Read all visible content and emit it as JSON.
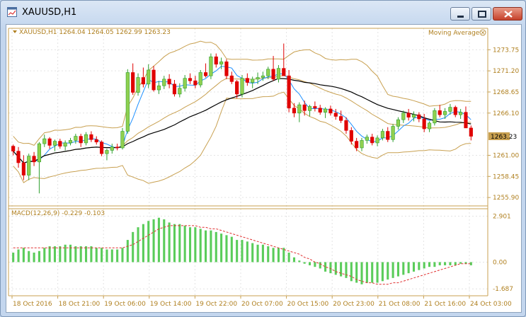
{
  "window": {
    "title": "XAUUSD,H1",
    "buttons": {
      "minimize": "minimize",
      "maximize": "maximize",
      "close": "close"
    }
  },
  "chart": {
    "header_text": "XAUUSD,H1  1264.04 1264.05 1262.99 1263.23",
    "indicator_label": "Moving Average",
    "current_price_label": "1263.23",
    "macd_label": "MACD(12,26,9) -0.229 -0.103",
    "colors": {
      "bull_candle": "#2ea02e",
      "bull_body": "#90d050",
      "bear_candle": "#e00000",
      "bollinger": "#c8a050",
      "ma_fast": "#1e90ff",
      "ma_slow": "#000000",
      "macd_hist": "#5acc5a",
      "macd_signal": "#e03030",
      "axis_text": "#b08020",
      "grid": "#e3e3e3"
    }
  },
  "chart_data": {
    "type": "candlestick",
    "symbol": "XAUUSD",
    "timeframe": "H1",
    "last_ohlc": {
      "open": 1264.04,
      "high": 1264.05,
      "low": 1262.99,
      "close": 1263.23
    },
    "price_axis": {
      "ticks": [
        1273.75,
        1271.2,
        1268.65,
        1266.1,
        1263.23,
        1261.0,
        1258.45,
        1255.9
      ],
      "range": [
        1255.4,
        1275.4
      ]
    },
    "time_axis": {
      "labels": [
        "18 Oct 2016",
        "18 Oct 21:00",
        "19 Oct 06:00",
        "19 Oct 14:00",
        "19 Oct 22:00",
        "20 Oct 07:00",
        "20 Oct 15:00",
        "20 Oct 23:00",
        "21 Oct 08:00",
        "21 Oct 16:00",
        "24 Oct 03:00"
      ]
    },
    "candles": [
      [
        1262.1,
        1262.3,
        1261.0,
        1261.5
      ],
      [
        1261.5,
        1262.0,
        1259.5,
        1260.1
      ],
      [
        1260.1,
        1261.0,
        1258.0,
        1258.6
      ],
      [
        1258.6,
        1261.2,
        1258.0,
        1260.9
      ],
      [
        1260.9,
        1261.4,
        1259.7,
        1260.2
      ],
      [
        1260.2,
        1262.6,
        1256.4,
        1262.4
      ],
      [
        1262.4,
        1263.5,
        1262.0,
        1263.0
      ],
      [
        1263.0,
        1263.2,
        1261.8,
        1262.2
      ],
      [
        1262.2,
        1262.9,
        1261.5,
        1262.7
      ],
      [
        1262.7,
        1263.0,
        1261.8,
        1262.1
      ],
      [
        1262.1,
        1262.8,
        1261.6,
        1262.5
      ],
      [
        1262.5,
        1263.1,
        1262.2,
        1262.8
      ],
      [
        1262.8,
        1263.6,
        1262.4,
        1263.3
      ],
      [
        1263.3,
        1263.6,
        1262.0,
        1262.5
      ],
      [
        1262.5,
        1263.8,
        1262.2,
        1263.5
      ],
      [
        1263.5,
        1263.9,
        1262.6,
        1262.9
      ],
      [
        1262.9,
        1263.3,
        1262.3,
        1262.6
      ],
      [
        1262.6,
        1262.8,
        1260.9,
        1261.2
      ],
      [
        1261.2,
        1261.8,
        1260.4,
        1261.6
      ],
      [
        1261.6,
        1262.4,
        1261.2,
        1262.0
      ],
      [
        1262.0,
        1262.4,
        1261.6,
        1261.9
      ],
      [
        1261.9,
        1264.3,
        1261.7,
        1263.9
      ],
      [
        1263.9,
        1271.4,
        1263.6,
        1271.0
      ],
      [
        1271.0,
        1272.1,
        1268.3,
        1268.6
      ],
      [
        1268.6,
        1270.9,
        1268.2,
        1270.4
      ],
      [
        1270.4,
        1271.6,
        1269.2,
        1269.6
      ],
      [
        1269.6,
        1272.0,
        1269.1,
        1271.3
      ],
      [
        1271.3,
        1271.8,
        1268.7,
        1268.9
      ],
      [
        1268.9,
        1270.0,
        1268.4,
        1269.4
      ],
      [
        1269.4,
        1270.6,
        1269.0,
        1270.2
      ],
      [
        1270.2,
        1270.8,
        1269.1,
        1269.6
      ],
      [
        1269.6,
        1270.1,
        1268.1,
        1268.4
      ],
      [
        1268.4,
        1269.7,
        1268.0,
        1269.1
      ],
      [
        1269.1,
        1270.7,
        1268.7,
        1270.3
      ],
      [
        1270.3,
        1270.9,
        1269.6,
        1270.0
      ],
      [
        1270.0,
        1270.6,
        1269.1,
        1269.5
      ],
      [
        1269.5,
        1271.3,
        1269.2,
        1271.0
      ],
      [
        1271.0,
        1272.1,
        1270.4,
        1270.6
      ],
      [
        1270.6,
        1273.3,
        1270.2,
        1272.9
      ],
      [
        1272.9,
        1273.3,
        1271.6,
        1272.0
      ],
      [
        1272.0,
        1272.8,
        1271.4,
        1272.3
      ],
      [
        1272.3,
        1272.6,
        1270.2,
        1270.6
      ],
      [
        1270.6,
        1271.1,
        1269.6,
        1269.9
      ],
      [
        1269.9,
        1270.1,
        1267.9,
        1268.4
      ],
      [
        1268.4,
        1270.7,
        1268.0,
        1270.3
      ],
      [
        1270.3,
        1270.9,
        1269.4,
        1269.8
      ],
      [
        1269.8,
        1270.5,
        1269.1,
        1270.2
      ],
      [
        1270.2,
        1271.0,
        1269.6,
        1270.4
      ],
      [
        1270.4,
        1271.1,
        1270.0,
        1270.6
      ],
      [
        1270.6,
        1271.7,
        1270.2,
        1271.4
      ],
      [
        1271.4,
        1273.0,
        1270.0,
        1270.2
      ],
      [
        1270.2,
        1271.9,
        1269.8,
        1271.5
      ],
      [
        1271.5,
        1274.5,
        1270.9,
        1270.6
      ],
      [
        1270.6,
        1271.3,
        1266.2,
        1266.7
      ],
      [
        1266.7,
        1267.3,
        1265.6,
        1266.1
      ],
      [
        1266.1,
        1267.4,
        1265.0,
        1267.1
      ],
      [
        1267.1,
        1267.6,
        1265.8,
        1266.4
      ],
      [
        1266.4,
        1267.1,
        1265.7,
        1266.9
      ],
      [
        1266.9,
        1267.5,
        1266.3,
        1266.7
      ],
      [
        1266.7,
        1267.1,
        1265.9,
        1266.2
      ],
      [
        1266.2,
        1266.8,
        1265.5,
        1266.6
      ],
      [
        1266.6,
        1267.0,
        1265.8,
        1266.1
      ],
      [
        1266.1,
        1266.6,
        1265.3,
        1265.7
      ],
      [
        1265.7,
        1266.4,
        1264.9,
        1265.2
      ],
      [
        1265.2,
        1265.6,
        1263.6,
        1264.0
      ],
      [
        1264.0,
        1264.4,
        1262.3,
        1262.7
      ],
      [
        1262.7,
        1263.1,
        1261.5,
        1261.9
      ],
      [
        1261.9,
        1263.1,
        1261.5,
        1262.8
      ],
      [
        1262.8,
        1263.5,
        1262.4,
        1263.2
      ],
      [
        1263.2,
        1263.6,
        1262.2,
        1262.5
      ],
      [
        1262.5,
        1263.4,
        1262.1,
        1263.1
      ],
      [
        1263.1,
        1264.2,
        1262.8,
        1263.9
      ],
      [
        1263.9,
        1264.4,
        1262.6,
        1262.9
      ],
      [
        1262.9,
        1264.8,
        1262.6,
        1264.5
      ],
      [
        1264.5,
        1265.6,
        1264.1,
        1265.3
      ],
      [
        1265.3,
        1266.4,
        1264.9,
        1266.1
      ],
      [
        1266.1,
        1266.6,
        1265.2,
        1265.6
      ],
      [
        1265.6,
        1266.3,
        1265.1,
        1265.9
      ],
      [
        1265.9,
        1266.2,
        1265.0,
        1265.4
      ],
      [
        1265.4,
        1266.0,
        1263.8,
        1264.2
      ],
      [
        1264.2,
        1265.1,
        1263.8,
        1264.9
      ],
      [
        1264.9,
        1266.7,
        1264.6,
        1266.4
      ],
      [
        1266.4,
        1267.1,
        1265.6,
        1265.9
      ],
      [
        1265.9,
        1266.7,
        1265.4,
        1266.3
      ],
      [
        1266.3,
        1267.2,
        1265.9,
        1266.8
      ],
      [
        1266.8,
        1267.0,
        1265.6,
        1265.9
      ],
      [
        1265.9,
        1266.6,
        1265.4,
        1266.2
      ],
      [
        1266.2,
        1266.9,
        1265.3,
        1264.3
      ],
      [
        1264.3,
        1264.6,
        1262.8,
        1263.3
      ]
    ],
    "macd": {
      "label": "MACD(12,26,9)",
      "main": -0.229,
      "signal": -0.103,
      "axis_ticks": [
        2.901,
        0.0,
        -1.687
      ],
      "range": [
        -1.9,
        3.1
      ],
      "histogram": [
        0.6,
        0.8,
        0.9,
        0.7,
        0.6,
        0.7,
        0.9,
        1.0,
        1.0,
        1.0,
        1.1,
        1.1,
        1.0,
        1.0,
        1.0,
        1.0,
        0.9,
        0.9,
        0.8,
        0.8,
        0.8,
        0.9,
        1.4,
        1.9,
        2.2,
        2.4,
        2.6,
        2.7,
        2.8,
        2.7,
        2.5,
        2.4,
        2.4,
        2.3,
        2.2,
        2.2,
        2.1,
        2.0,
        2.0,
        1.9,
        1.8,
        1.7,
        1.6,
        1.4,
        1.4,
        1.3,
        1.2,
        1.1,
        1.1,
        1.0,
        0.9,
        0.9,
        0.9,
        0.6,
        0.3,
        0.1,
        -0.1,
        -0.2,
        -0.3,
        -0.4,
        -0.6,
        -0.7,
        -0.8,
        -0.9,
        -1.0,
        -1.2,
        -1.3,
        -1.4,
        -1.3,
        -1.3,
        -1.3,
        -1.2,
        -1.1,
        -1.0,
        -0.9,
        -0.8,
        -0.7,
        -0.6,
        -0.5,
        -0.4,
        -0.3,
        -0.3,
        -0.2,
        -0.2,
        -0.2,
        -0.2,
        -0.1,
        -0.1,
        -0.2
      ],
      "signal_line": [
        0.9,
        0.9,
        0.9,
        0.9,
        0.9,
        0.9,
        0.9,
        0.9,
        0.9,
        0.9,
        0.9,
        0.9,
        0.9,
        0.9,
        0.9,
        0.9,
        0.9,
        0.9,
        0.9,
        0.9,
        0.9,
        0.9,
        1.0,
        1.1,
        1.3,
        1.5,
        1.7,
        1.9,
        2.1,
        2.2,
        2.3,
        2.3,
        2.3,
        2.3,
        2.3,
        2.3,
        2.2,
        2.2,
        2.1,
        2.1,
        2.0,
        1.9,
        1.8,
        1.7,
        1.6,
        1.5,
        1.4,
        1.3,
        1.2,
        1.1,
        1.0,
        0.9,
        0.8,
        0.7,
        0.6,
        0.5,
        0.3,
        0.2,
        0.0,
        -0.1,
        -0.3,
        -0.4,
        -0.6,
        -0.7,
        -0.8,
        -0.9,
        -1.1,
        -1.2,
        -1.3,
        -1.3,
        -1.4,
        -1.4,
        -1.4,
        -1.3,
        -1.3,
        -1.2,
        -1.1,
        -1.0,
        -0.9,
        -0.8,
        -0.7,
        -0.6,
        -0.5,
        -0.4,
        -0.3,
        -0.2,
        -0.1,
        -0.1,
        -0.1
      ]
    }
  }
}
